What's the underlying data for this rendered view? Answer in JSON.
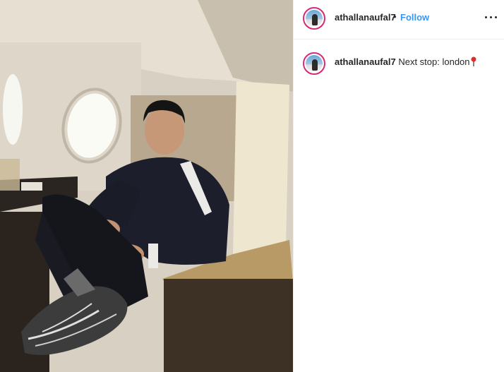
{
  "post": {
    "username": "athallanaufal7",
    "separator": "•",
    "follow_label": "Follow",
    "caption": "Next stop: london",
    "caption_emoji": "pin-icon"
  },
  "icons": {
    "more": "more-options-icon",
    "avatar": "avatar"
  },
  "colors": {
    "follow": "#3897f0",
    "text": "#262626",
    "avatar_ring": "#d62976"
  }
}
